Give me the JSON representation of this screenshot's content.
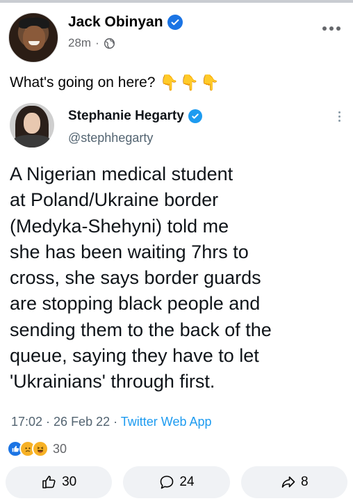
{
  "post": {
    "author": "Jack Obinyan",
    "time": "28m",
    "separator": "·",
    "caption": "What's going on here?",
    "caption_emoji": "👇👇👇"
  },
  "tweet": {
    "name": "Stephanie Hegarty",
    "handle": "@stephhegarty",
    "lines": [
      "A Nigerian medical student",
      "at Poland/Ukraine border",
      "(Medyka-Shehyni) told me",
      "she has been waiting 7hrs to",
      "cross, she says border guards",
      "are stopping black people and",
      "sending them to the back of the",
      "queue, saying they have to let",
      "'Ukrainians' through first."
    ],
    "timestamp": "17:02 · 26 Feb 22 · ",
    "source": "Twitter Web App"
  },
  "reactions": {
    "count": "30",
    "icons": [
      "like-reaction-icon",
      "sad-reaction-icon",
      "haha-reaction-icon"
    ]
  },
  "actions": {
    "like_count": "30",
    "comment_count": "24",
    "share_count": "8"
  },
  "colors": {
    "fb_blue": "#1b74e4",
    "twitter_blue": "#1d9bf0",
    "button_bg": "#f0f2f5",
    "meta_gray": "#65676b"
  }
}
